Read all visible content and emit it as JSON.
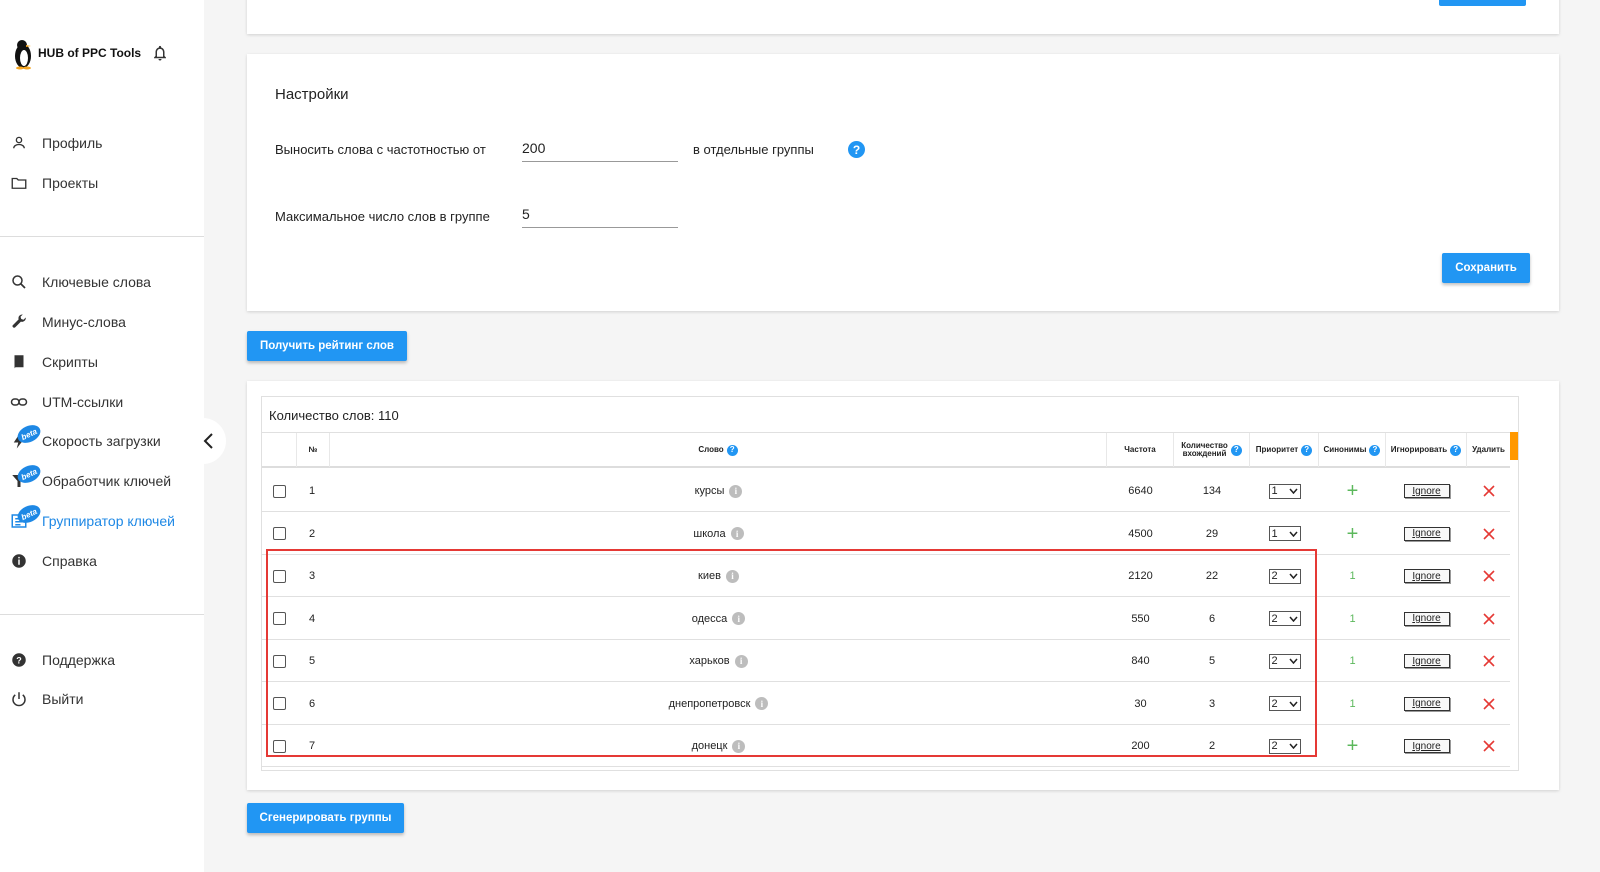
{
  "sidebar": {
    "brand": "HUB of PPC Tools",
    "items": [
      {
        "label": "Профиль",
        "icon": "person-icon",
        "key": "profile"
      },
      {
        "label": "Проекты",
        "icon": "folder-icon",
        "key": "projects"
      },
      {
        "label": "Ключевые слова",
        "icon": "search-icon",
        "key": "keywords"
      },
      {
        "label": "Минус-слова",
        "icon": "wrench-icon",
        "key": "minus-words"
      },
      {
        "label": "Скрипты",
        "icon": "book-icon",
        "key": "scripts"
      },
      {
        "label": "UTM-ссылки",
        "icon": "link-icon",
        "key": "utm-links"
      },
      {
        "label": "Скорость загрузки",
        "icon": "lightning-icon",
        "key": "load-speed",
        "beta": "beta"
      },
      {
        "label": "Обработчик ключей",
        "icon": "filter-icon",
        "key": "key-processor",
        "beta": "beta"
      },
      {
        "label": "Группиратор ключей",
        "icon": "list-icon",
        "key": "key-grouper",
        "beta": "beta",
        "active": true
      },
      {
        "label": "Справка",
        "icon": "info-icon",
        "key": "help"
      },
      {
        "label": "Поддержка",
        "icon": "help-circle-icon",
        "key": "support"
      },
      {
        "label": "Выйти",
        "icon": "power-icon",
        "key": "logout"
      }
    ]
  },
  "settings": {
    "title": "Настройки",
    "freq_label": "Выносить слова с частотностью от",
    "freq_value": "200",
    "freq_suffix": "в отдельные группы",
    "max_label": "Максимальное число слов в группе",
    "max_value": "5",
    "save_label": "Сохранить"
  },
  "rating_button": "Получить рейтинг слов",
  "generate_button": "Сгенерировать группы",
  "table": {
    "count_label": "Количество слов: 110",
    "headers": {
      "num": "№",
      "word": "Слово",
      "freq": "Частота",
      "occurrences_1": "Количество",
      "occurrences_2": "вхождений",
      "priority": "Приоритет",
      "synonyms": "Синонимы",
      "ignore": "Игнорировать",
      "delete": "Удалить"
    },
    "ignore_label": "Ignore",
    "rows": [
      {
        "num": "1",
        "word": "курсы",
        "freq": "6640",
        "occ": "134",
        "priority": "1",
        "syn": "+"
      },
      {
        "num": "2",
        "word": "школа",
        "freq": "4500",
        "occ": "29",
        "priority": "1",
        "syn": "+"
      },
      {
        "num": "3",
        "word": "киев",
        "freq": "2120",
        "occ": "22",
        "priority": "2",
        "syn": "1"
      },
      {
        "num": "4",
        "word": "одесса",
        "freq": "550",
        "occ": "6",
        "priority": "2",
        "syn": "1"
      },
      {
        "num": "5",
        "word": "харьков",
        "freq": "840",
        "occ": "5",
        "priority": "2",
        "syn": "1"
      },
      {
        "num": "6",
        "word": "днепропетровск",
        "freq": "30",
        "occ": "3",
        "priority": "2",
        "syn": "1"
      },
      {
        "num": "7",
        "word": "донецк",
        "freq": "200",
        "occ": "2",
        "priority": "2",
        "syn": "+"
      }
    ]
  },
  "colors": {
    "accent": "#2196f3",
    "highlight": "#e53935",
    "plus": "#5cb85c",
    "delete": "#e53935"
  }
}
